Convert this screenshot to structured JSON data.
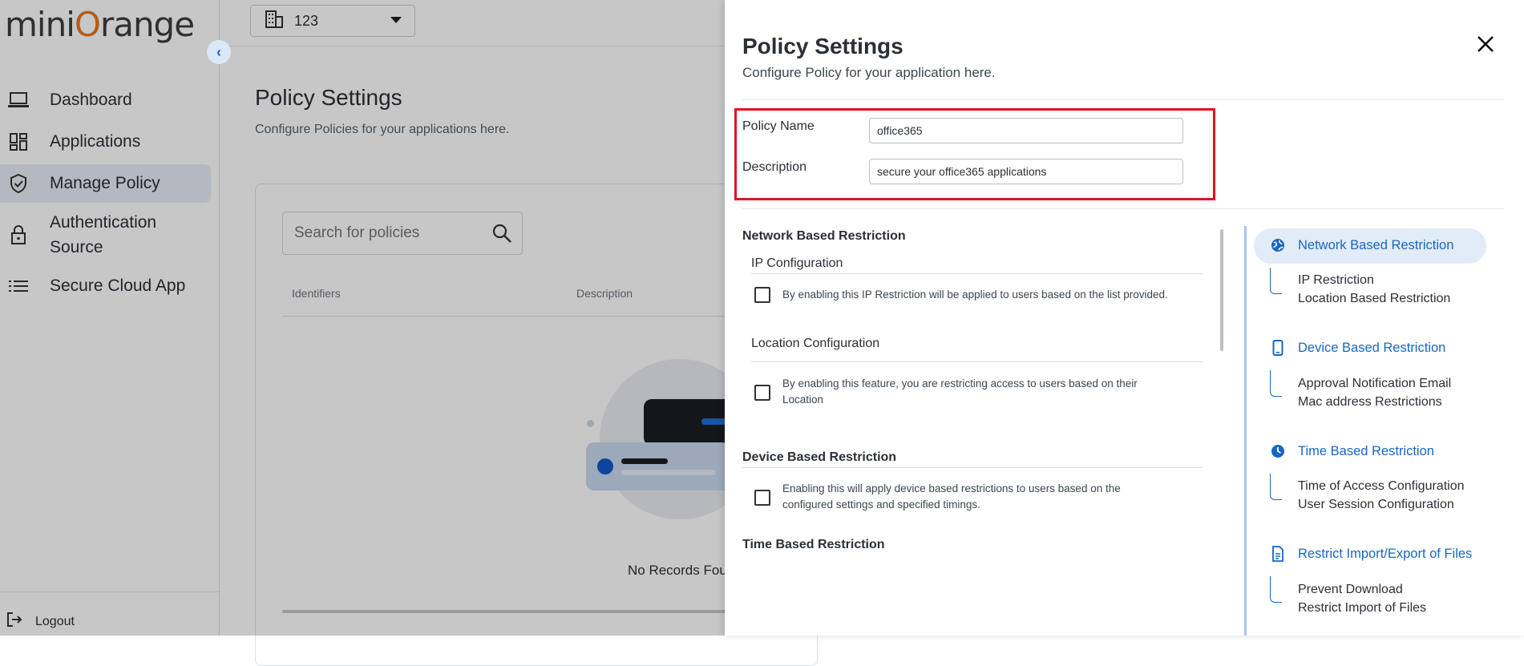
{
  "sidebar": {
    "logo": {
      "pre": "mini",
      "o": "O",
      "post": "range"
    },
    "items": [
      {
        "label": "Dashboard",
        "icon": "laptop-icon"
      },
      {
        "label": "Applications",
        "icon": "grid-icon"
      },
      {
        "label": "Manage Policy",
        "icon": "shield-icon"
      },
      {
        "label": "Authentication Source",
        "icon": "lock-icon"
      },
      {
        "label": "Secure Cloud App",
        "icon": "list-icon"
      }
    ],
    "logout": "Logout"
  },
  "topbar": {
    "org_value": "123"
  },
  "page": {
    "title": "Policy Settings",
    "subtitle": "Configure Policies for your applications here.",
    "search_placeholder": "Search for policies",
    "columns": [
      "Identifiers",
      "Description"
    ],
    "empty_text": "No Records Foun"
  },
  "drawer": {
    "title": "Policy Settings",
    "subtitle": "Configure Policy for your application here.",
    "policy_name_label": "Policy Name",
    "policy_name_value": "office365",
    "description_label": "Description",
    "description_value": "secure your office365 applications",
    "network_title": "Network Based Restriction",
    "ip_title": "IP Configuration",
    "ip_text": "By enabling this IP Restriction will be applied to users based on the list provided.",
    "location_title": "Location Configuration",
    "location_text_1": "By enabling this feature, you are restricting access to users based on their",
    "location_text_2": "Location",
    "device_title": "Device Based Restriction",
    "device_text_1": "Enabling this will apply device based restrictions to users based on the",
    "device_text_2": "configured settings and specified timings.",
    "time_title": "Time Based Restriction",
    "nav": [
      {
        "label": "Network Based Restriction",
        "icon": "globe-icon",
        "subs": [
          "IP Restriction",
          "Location Based Restriction"
        ]
      },
      {
        "label": "Device Based Restriction",
        "icon": "phone-icon",
        "subs": [
          "Approval Notification Email",
          "Mac address Restrictions"
        ]
      },
      {
        "label": "Time Based Restriction",
        "icon": "clock-icon",
        "subs": [
          "Time of Access Configuration",
          "User Session Configuration"
        ]
      },
      {
        "label": "Restrict Import/Export of Files",
        "icon": "file-icon",
        "subs": [
          "Prevent Download",
          "Restrict Import of Files"
        ]
      }
    ]
  },
  "colors": {
    "accent": "#1867c0",
    "highlight": "#e0141e",
    "brand_orange": "#e8761f"
  }
}
